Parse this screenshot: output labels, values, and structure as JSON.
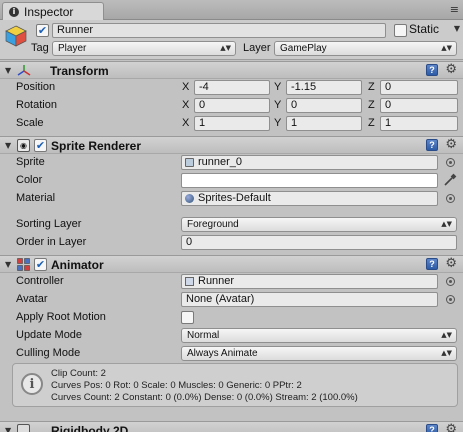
{
  "window": {
    "tab_label": "Inspector",
    "tab_icon": "info-icon",
    "menu_icon": "panel-menu-icon"
  },
  "gameobject": {
    "active": true,
    "name": "Runner",
    "static_label": "Static",
    "static": false,
    "tag_label": "Tag",
    "tag_value": "Player",
    "layer_label": "Layer",
    "layer_value": "GamePlay"
  },
  "transform": {
    "title": "Transform",
    "position_label": "Position",
    "rotation_label": "Rotation",
    "scale_label": "Scale",
    "axis_x": "X",
    "axis_y": "Y",
    "axis_z": "Z",
    "position": {
      "x": "-4",
      "y": "-1.15",
      "z": "0"
    },
    "rotation": {
      "x": "0",
      "y": "0",
      "z": "0"
    },
    "scale": {
      "x": "1",
      "y": "1",
      "z": "1"
    }
  },
  "sprite_renderer": {
    "title": "Sprite Renderer",
    "enabled": true,
    "sprite_label": "Sprite",
    "sprite_value": "runner_0",
    "color_label": "Color",
    "color_value": "#ffffff",
    "material_label": "Material",
    "material_value": "Sprites-Default",
    "sorting_layer_label": "Sorting Layer",
    "sorting_layer_value": "Foreground",
    "order_label": "Order in Layer",
    "order_value": "0"
  },
  "animator": {
    "title": "Animator",
    "enabled": true,
    "controller_label": "Controller",
    "controller_value": "Runner",
    "avatar_label": "Avatar",
    "avatar_value": "None (Avatar)",
    "root_motion_label": "Apply Root Motion",
    "root_motion": false,
    "update_mode_label": "Update Mode",
    "update_mode_value": "Normal",
    "culling_mode_label": "Culling Mode",
    "culling_mode_value": "Always Animate",
    "info": {
      "line1": "Clip Count: 2",
      "line2": "Curves Pos: 0 Rot: 0 Scale: 0 Muscles: 0 Generic: 0 PPtr: 2",
      "line3": "Curves Count: 2 Constant: 0 (0.0%) Dense: 0 (0.0%) Stream: 2 (100.0%)"
    }
  },
  "rigidbody": {
    "title": "Rigidbody 2D"
  },
  "colors": {
    "panel_bg": "#c2c2c2",
    "help_icon": "#3a67b3",
    "checkbox_check": "#1b5fb6"
  }
}
